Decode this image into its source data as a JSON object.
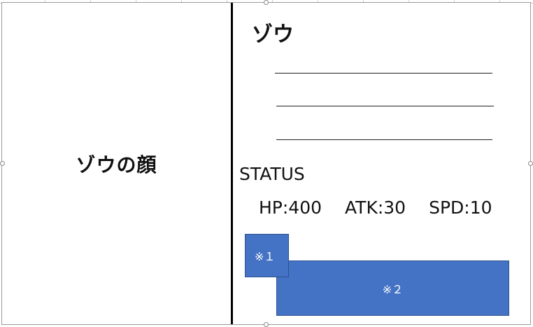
{
  "card": {
    "face_label": "ゾウの顔",
    "name": "ゾウ",
    "status_title": "STATUS",
    "stats": {
      "hp": "HP:400",
      "atk": "ATK:30",
      "spd": "SPD:10"
    },
    "note1": "※１",
    "note2": "※２"
  },
  "colors": {
    "note_fill": "#4472c4",
    "divider": "#000000"
  }
}
